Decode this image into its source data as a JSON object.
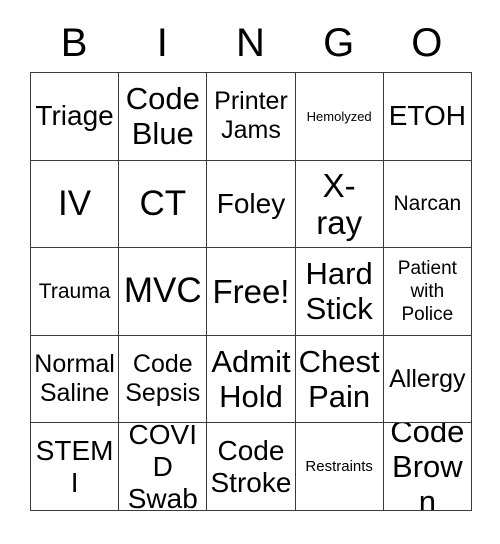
{
  "card": {
    "header_letters": [
      "B",
      "I",
      "N",
      "G",
      "O"
    ],
    "colors": {
      "background": "#ffffff",
      "text": "#000000",
      "grid_line": "#3a3a3a"
    },
    "grid": {
      "columns": 5,
      "rows": 5,
      "free_space_label": "Free!",
      "cells": [
        [
          {
            "text": "Triage",
            "size": "md"
          },
          {
            "text": "Code\nBlue",
            "size": "lg"
          },
          {
            "text": "Printer\nJams",
            "size": "sm"
          },
          {
            "text": "Hemolyzed",
            "size": "micro"
          },
          {
            "text": "ETOH",
            "size": "md"
          }
        ],
        [
          {
            "text": "IV",
            "size": "xxl"
          },
          {
            "text": "CT",
            "size": "xxl"
          },
          {
            "text": "Foley",
            "size": "md"
          },
          {
            "text": "X-\nray",
            "size": "xl"
          },
          {
            "text": "Narcan",
            "size": "xs"
          }
        ],
        [
          {
            "text": "Trauma",
            "size": "xs"
          },
          {
            "text": "MVC",
            "size": "xxl"
          },
          {
            "text": "Free!",
            "size": "xl"
          },
          {
            "text": "Hard\nStick",
            "size": "lg"
          },
          {
            "text": "Patient\nwith\nPolice",
            "size": "xxs"
          }
        ],
        [
          {
            "text": "Normal\nSaline",
            "size": "sm"
          },
          {
            "text": "Code\nSepsis",
            "size": "sm"
          },
          {
            "text": "Admit\nHold",
            "size": "lg"
          },
          {
            "text": "Chest\nPain",
            "size": "lg"
          },
          {
            "text": "Allergy",
            "size": "sm"
          }
        ],
        [
          {
            "text": "STEMI",
            "size": "md"
          },
          {
            "text": "COVID\nSwab",
            "size": "md"
          },
          {
            "text": "Code\nStroke",
            "size": "md"
          },
          {
            "text": "Restraints",
            "size": "tiny"
          },
          {
            "text": "Code\nBrown",
            "size": "lg"
          }
        ]
      ]
    }
  }
}
